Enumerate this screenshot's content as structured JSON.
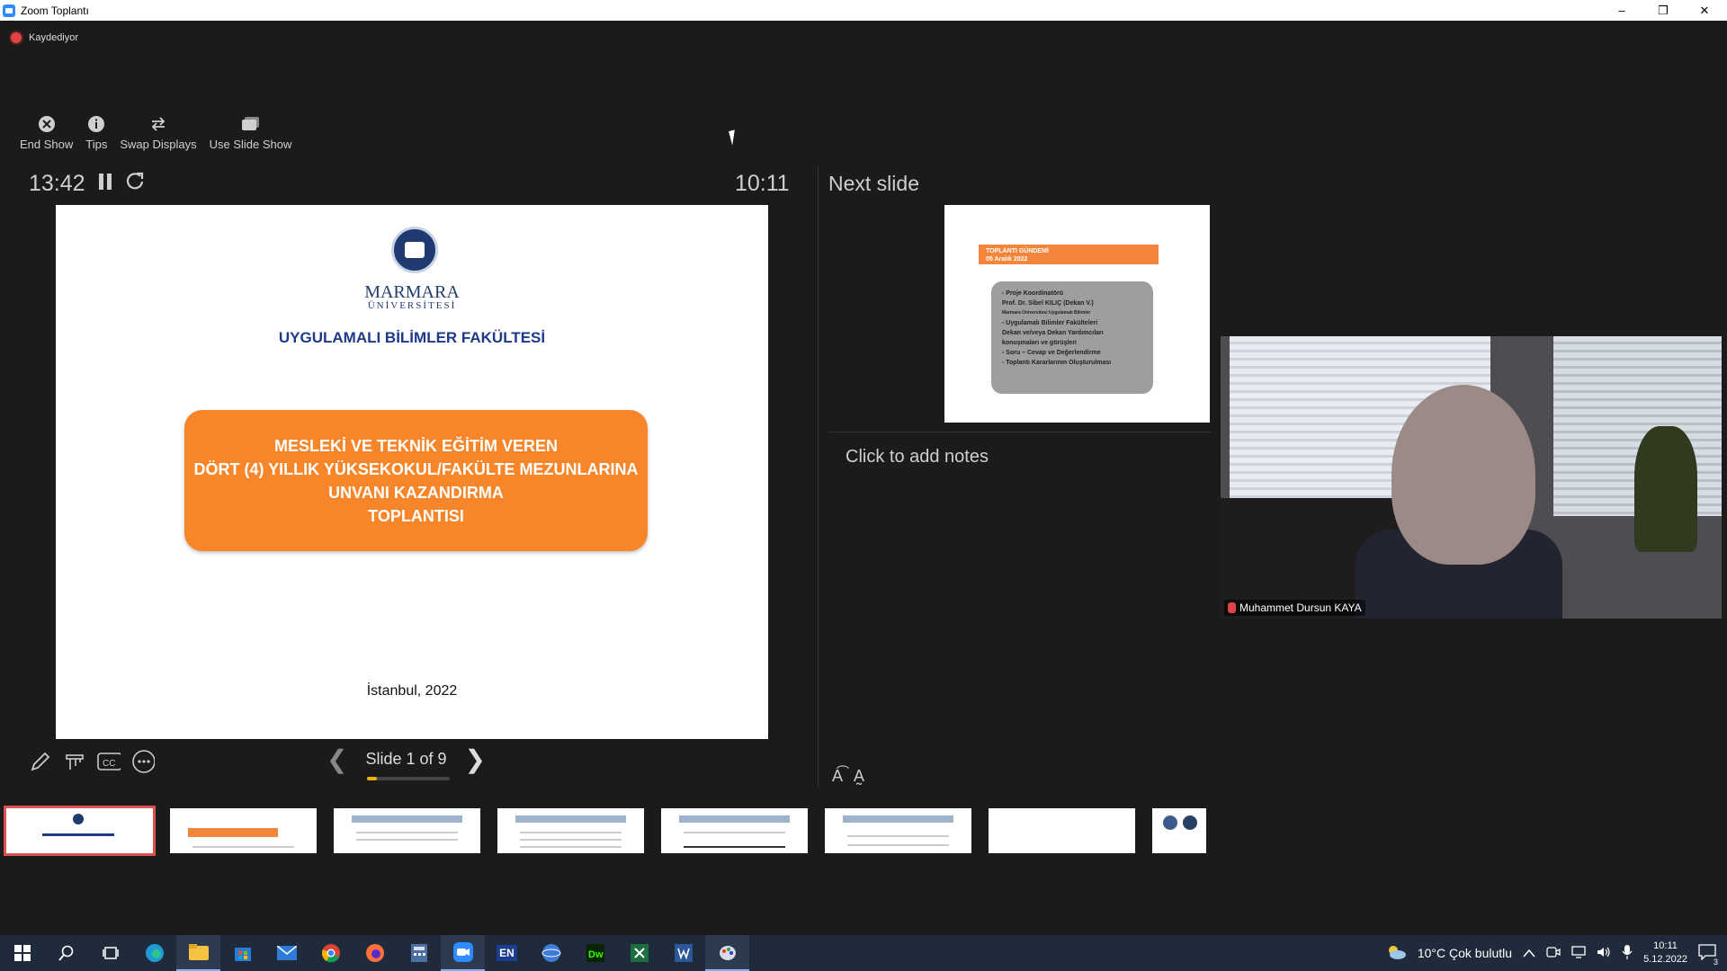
{
  "window": {
    "title": "Zoom Toplantı",
    "minimize": "–",
    "restore": "❐",
    "close": "✕"
  },
  "recording": {
    "label": "Kaydediyor"
  },
  "toolbar": [
    {
      "label": "End Show",
      "icon": "end-show-icon"
    },
    {
      "label": "Tips",
      "icon": "info-icon"
    },
    {
      "label": "Swap Displays",
      "icon": "swap-icon"
    },
    {
      "label": "Use Slide Show",
      "icon": "slideshow-icon"
    }
  ],
  "timer": {
    "elapsed": "13:42",
    "clock": "10:11"
  },
  "slide": {
    "university_line1": "MARMARA",
    "university_line2": "ÜNİVERSİTESİ",
    "faculty": "UYGULAMALI BİLİMLER FAKÜLTESİ",
    "box_lines": [
      "MESLEKİ VE TEKNİK EĞİTİM VEREN",
      "DÖRT (4) YILLIK YÜKSEKOKUL/FAKÜLTE MEZUNLARINA",
      "UNVANI KAZANDIRMA",
      "TOPLANTISI"
    ],
    "place": "İstanbul, 2022"
  },
  "navigation": {
    "label": "Slide 1 of 9",
    "current": 1,
    "total": 9,
    "prev": "❮",
    "next": "❯"
  },
  "next_slide": {
    "label": "Next slide",
    "band_title": "TOPLANTI GÜNDEMİ",
    "band_date": "05 Aralık 2022",
    "items": [
      "- Proje Koordinatörü",
      "Prof. Dr. Sibel KILIÇ (Dekan V.)",
      "Marmara Üniversitesi Uygulamalı Bilimler",
      "- Uygulamalı Bilimler Fakülteleri",
      "Dekan ve/veya Dekan Yardımcıları",
      "konuşmaları ve görüşleri",
      "- Soru – Cevap ve Değerlendirme",
      "- Toplantı Kararlarının Oluşturulması"
    ]
  },
  "notes": {
    "placeholder": "Click to add notes"
  },
  "font_controls": {
    "increase": "A͡",
    "decrease": "A̰"
  },
  "participant": {
    "name": "Muhammet Dursun KAYA"
  },
  "taskbar": {
    "weather": "10°C  Çok bulutlu",
    "time": "10:11",
    "date": "5.12.2022",
    "notifications": "3",
    "lang": "EN"
  }
}
